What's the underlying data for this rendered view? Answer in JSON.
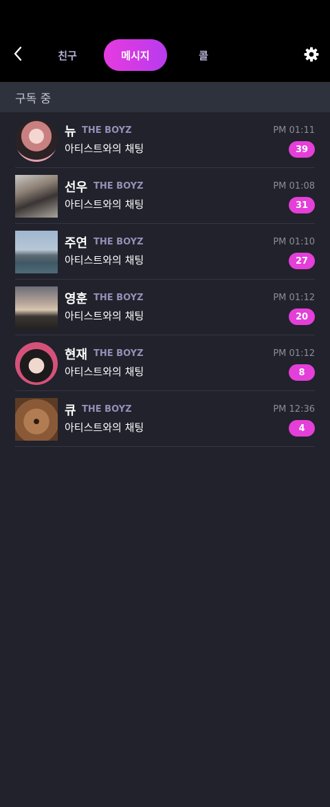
{
  "header": {
    "tabs": [
      {
        "label": "친구",
        "active": false
      },
      {
        "label": "메시지",
        "active": true
      },
      {
        "label": "콜",
        "active": false
      }
    ],
    "back_icon": "chevron-left-icon",
    "settings_icon": "gear-icon",
    "accent_color": "#e43fd8"
  },
  "section": {
    "title": "구독 중"
  },
  "chats": [
    {
      "name": "뉴",
      "group": "THE BOYZ",
      "subtitle": "아티스트와의 채팅",
      "time": "PM 01:11",
      "unread": "39"
    },
    {
      "name": "선우",
      "group": "THE BOYZ",
      "subtitle": "아티스트와의 채팅",
      "time": "PM 01:08",
      "unread": "31"
    },
    {
      "name": "주연",
      "group": "THE BOYZ",
      "subtitle": "아티스트와의 채팅",
      "time": "PM 01:10",
      "unread": "27"
    },
    {
      "name": "영훈",
      "group": "THE BOYZ",
      "subtitle": "아티스트와의 채팅",
      "time": "PM 01:12",
      "unread": "20"
    },
    {
      "name": "현재",
      "group": "THE BOYZ",
      "subtitle": "아티스트와의 채팅",
      "time": "PM 01:12",
      "unread": "8"
    },
    {
      "name": "큐",
      "group": "THE BOYZ",
      "subtitle": "아티스트와의 채팅",
      "time": "PM 12:36",
      "unread": "4"
    }
  ]
}
